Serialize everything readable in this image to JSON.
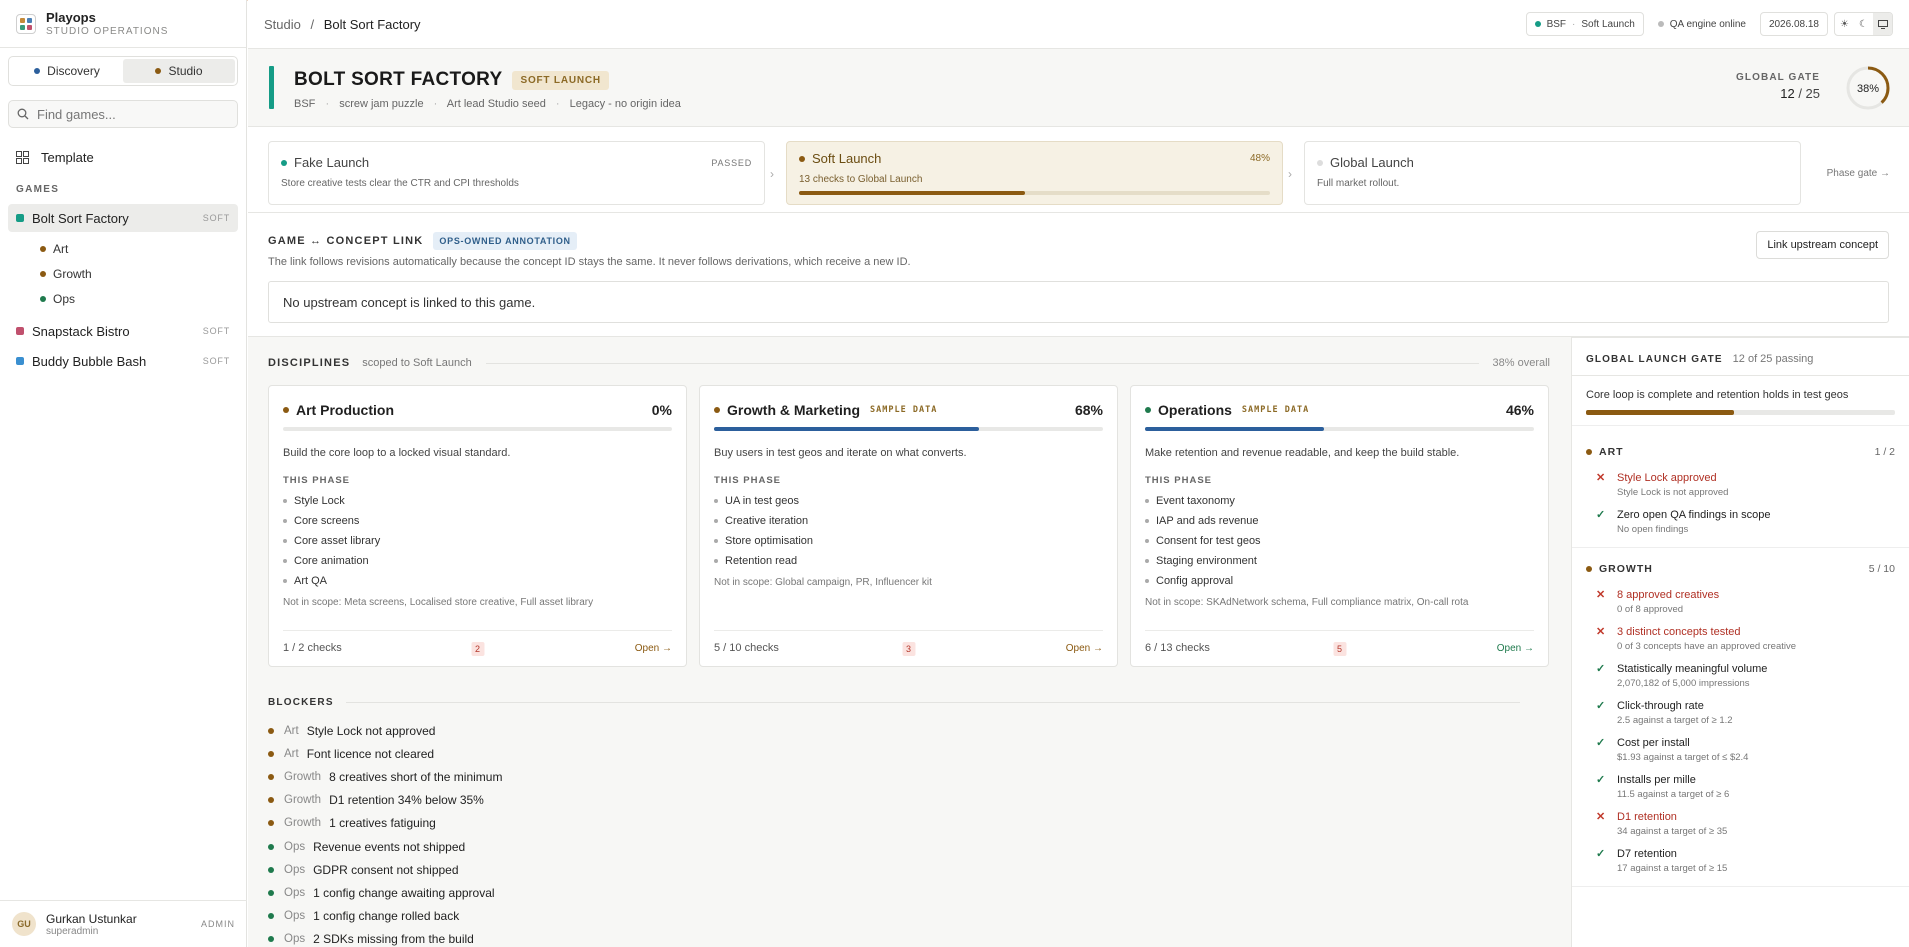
{
  "app": {
    "name": "Playops",
    "subtitle": "STUDIO OPERATIONS"
  },
  "colors": {
    "teal": "#159c86",
    "amber": "#8b5a12",
    "green": "#1f7a4d",
    "blue": "#2c5f9c",
    "pink": "#c0506d",
    "red": "#c0392b"
  },
  "mode": {
    "discovery": "Discovery",
    "studio": "Studio"
  },
  "search": {
    "placeholder": "Find games..."
  },
  "sidebar": {
    "template": "Template",
    "games_heading": "GAMES",
    "games": [
      {
        "name": "Bolt Sort Factory",
        "badge": "SOFT",
        "color": "#159c86"
      },
      {
        "name": "Snapstack Bistro",
        "badge": "SOFT",
        "color": "#c0506d"
      },
      {
        "name": "Buddy Bubble Bash",
        "badge": "SOFT",
        "color": "#3a8fd0"
      }
    ],
    "subitems": [
      "Art",
      "Growth",
      "Ops"
    ]
  },
  "user": {
    "initials": "GU",
    "name": "Gurkan Ustunkar",
    "role": "superadmin",
    "badge": "ADMIN"
  },
  "topbar": {
    "crumb1": "Studio",
    "sep": "/",
    "crumb2": "Bolt Sort Factory",
    "code": "BSF",
    "phase": "Soft Launch",
    "qa": "QA engine online",
    "date": "2026.08.18"
  },
  "game": {
    "title": "BOLT SORT FACTORY",
    "badge": "SOFT LAUNCH",
    "code": "BSF",
    "genre": "screw jam puzzle",
    "art_lead": "Art lead Studio seed",
    "origin": "Legacy - no origin idea"
  },
  "gate": {
    "label": "GLOBAL GATE",
    "passed": "12",
    "total": "/ 25",
    "percent_label": "38%",
    "percent": 38
  },
  "phases": [
    {
      "name": "Fake Launch",
      "status": "PASSED",
      "desc": "Store creative tests clear the CTR and CPI thresholds"
    },
    {
      "name": "Soft Launch",
      "status": "48%",
      "desc": "13 checks to Global Launch",
      "progress": 48
    },
    {
      "name": "Global Launch",
      "status": "",
      "desc": "Full market rollout."
    }
  ],
  "phase_gate": "Phase gate →",
  "concept": {
    "title": "GAME ↔ CONCEPT LINK",
    "badge": "OPS-OWNED ANNOTATION",
    "desc": "The link follows revisions automatically because the concept ID stays the same. It never follows derivations, which receive a new ID.",
    "button": "Link upstream concept",
    "empty": "No upstream concept is linked to this game."
  },
  "disciplines": {
    "title": "DISCIPLINES",
    "scope": "scoped to Soft Launch",
    "overall": "38% overall",
    "this_phase": "THIS PHASE",
    "open": "Open →",
    "cards": [
      {
        "name": "Art Production",
        "sample": "",
        "pct": "0%",
        "progress": 0,
        "color": "#8b5a12",
        "desc": "Build the core loop to a locked visual standard.",
        "items": [
          "Style Lock",
          "Core screens",
          "Core asset library",
          "Core animation",
          "Art QA"
        ],
        "not_in_scope": "Not in scope: Meta screens, Localised store creative, Full asset library",
        "checks": "1 / 2 checks",
        "count": "2",
        "open_color": "#8b5a12"
      },
      {
        "name": "Growth & Marketing",
        "sample": "SAMPLE DATA",
        "pct": "68%",
        "progress": 68,
        "color": "#8b5a12",
        "desc": "Buy users in test geos and iterate on what converts.",
        "items": [
          "UA in test geos",
          "Creative iteration",
          "Store optimisation",
          "Retention read"
        ],
        "not_in_scope": "Not in scope: Global campaign, PR, Influencer kit",
        "checks": "5 / 10 checks",
        "count": "3",
        "open_color": "#8b5a12"
      },
      {
        "name": "Operations",
        "sample": "SAMPLE DATA",
        "pct": "46%",
        "progress": 46,
        "color": "#1f7a4d",
        "desc": "Make retention and revenue readable, and keep the build stable.",
        "items": [
          "Event taxonomy",
          "IAP and ads revenue",
          "Consent for test geos",
          "Staging environment",
          "Config approval"
        ],
        "not_in_scope": "Not in scope: SKAdNetwork schema, Full compliance matrix, On-call rota",
        "checks": "6 / 13 checks",
        "count": "5",
        "open_color": "#1f7a4d"
      }
    ]
  },
  "blockers": {
    "title": "BLOCKERS",
    "items": [
      {
        "d": "Art",
        "t": "Style Lock not approved",
        "c": "#8b5a12"
      },
      {
        "d": "Art",
        "t": "Font licence not cleared",
        "c": "#8b5a12"
      },
      {
        "d": "Growth",
        "t": "8 creatives short of the minimum",
        "c": "#8b5a12"
      },
      {
        "d": "Growth",
        "t": "D1 retention 34% below 35%",
        "c": "#8b5a12"
      },
      {
        "d": "Growth",
        "t": "1 creatives fatiguing",
        "c": "#8b5a12"
      },
      {
        "d": "Ops",
        "t": "Revenue events not shipped",
        "c": "#1f7a4d"
      },
      {
        "d": "Ops",
        "t": "GDPR consent not shipped",
        "c": "#1f7a4d"
      },
      {
        "d": "Ops",
        "t": "1 config change awaiting approval",
        "c": "#1f7a4d"
      },
      {
        "d": "Ops",
        "t": "1 config change rolled back",
        "c": "#1f7a4d"
      },
      {
        "d": "Ops",
        "t": "2 SDKs missing from the build",
        "c": "#1f7a4d"
      }
    ]
  },
  "launch_gate": {
    "title": "GLOBAL LAUNCH GATE",
    "summary": "12 of 25 passing",
    "criterion": "Core loop is complete and retention holds in test geos",
    "progress": 48,
    "groups": [
      {
        "name": "ART",
        "count": "1 / 2",
        "checks": [
          {
            "pass": false,
            "title": "Style Lock approved",
            "sub": "Style Lock is not approved"
          },
          {
            "pass": true,
            "title": "Zero open QA findings in scope",
            "sub": "No open findings"
          }
        ]
      },
      {
        "name": "GROWTH",
        "count": "5 / 10",
        "checks": [
          {
            "pass": false,
            "title": "8 approved creatives",
            "sub": "0 of 8 approved"
          },
          {
            "pass": false,
            "title": "3 distinct concepts tested",
            "sub": "0 of 3 concepts have an approved creative"
          },
          {
            "pass": true,
            "title": "Statistically meaningful volume",
            "sub": "2,070,182 of 5,000 impressions"
          },
          {
            "pass": true,
            "title": "Click-through rate",
            "sub": "2.5 against a target of ≥ 1.2"
          },
          {
            "pass": true,
            "title": "Cost per install",
            "sub": "$1.93 against a target of ≤ $2.4"
          },
          {
            "pass": true,
            "title": "Installs per mille",
            "sub": "11.5 against a target of ≥ 6"
          },
          {
            "pass": false,
            "title": "D1 retention",
            "sub": "34 against a target of ≥ 35"
          },
          {
            "pass": true,
            "title": "D7 retention",
            "sub": "17 against a target of ≥ 15"
          }
        ]
      }
    ]
  }
}
